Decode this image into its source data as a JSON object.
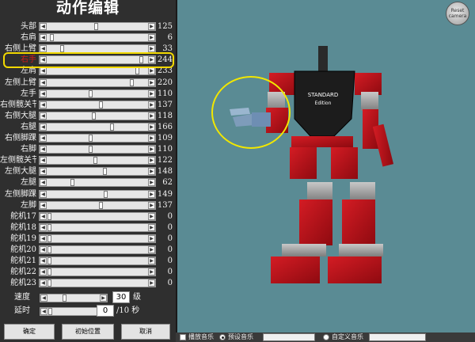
{
  "title": "动作编辑",
  "servos": [
    {
      "label": "头部",
      "value": 125,
      "red": false
    },
    {
      "label": "右肩",
      "value": 6,
      "red": false
    },
    {
      "label": "右侧上臂",
      "value": 33,
      "red": false
    },
    {
      "label": "右手",
      "value": 244,
      "red": true
    },
    {
      "label": "左肩",
      "value": 233,
      "red": false
    },
    {
      "label": "左侧上臂",
      "value": 220,
      "red": false
    },
    {
      "label": "左手",
      "value": 110,
      "red": false
    },
    {
      "label": "右侧髋关节",
      "value": 137,
      "red": false
    },
    {
      "label": "右侧大腿",
      "value": 118,
      "red": false
    },
    {
      "label": "右腿",
      "value": 166,
      "red": false
    },
    {
      "label": "右侧脚踝",
      "value": 109,
      "red": false
    },
    {
      "label": "右脚",
      "value": 110,
      "red": false
    },
    {
      "label": "左侧髋关节",
      "value": 122,
      "red": false
    },
    {
      "label": "左侧大腿",
      "value": 148,
      "red": false
    },
    {
      "label": "左腿",
      "value": 62,
      "red": false
    },
    {
      "label": "左侧脚踝",
      "value": 149,
      "red": false
    },
    {
      "label": "左脚",
      "value": 137,
      "red": false
    },
    {
      "label": "舵机17",
      "value": 0,
      "red": false
    },
    {
      "label": "舵机18",
      "value": 0,
      "red": false
    },
    {
      "label": "舵机19",
      "value": 0,
      "red": false
    },
    {
      "label": "舵机20",
      "value": 0,
      "red": false
    },
    {
      "label": "舵机21",
      "value": 0,
      "red": false
    },
    {
      "label": "舵机22",
      "value": 0,
      "red": false
    },
    {
      "label": "舵机23",
      "value": 0,
      "red": false
    }
  ],
  "speed": {
    "label": "速度",
    "value": "30",
    "unit": "级",
    "level": 0.3
  },
  "delay": {
    "label": "延时",
    "value": "0",
    "unit": "/10 秒",
    "level": 0.0
  },
  "buttons": {
    "confirm": "确定",
    "initial": "初始位置",
    "cancel": "取消"
  },
  "reset_camera": {
    "line1": "Reset",
    "line2": "camera"
  },
  "robot_chest_text": {
    "line1": "STANDARD",
    "line2": "Edition"
  },
  "bottom": {
    "play_music": "播放音乐",
    "preset_music": "预设音乐",
    "custom_music": "自定义音乐"
  },
  "colors": {
    "viewport_bg": "#5a8b94",
    "robot_red": "#b3111a",
    "highlight": "#f2d800"
  }
}
